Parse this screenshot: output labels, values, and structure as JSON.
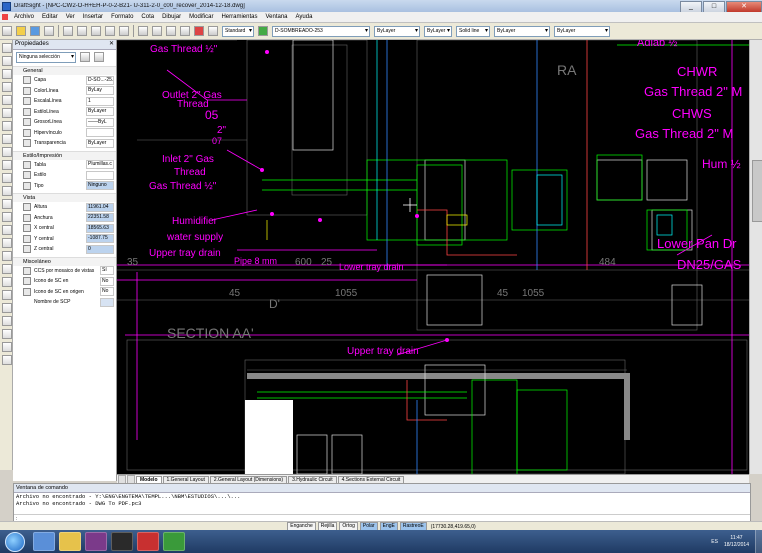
{
  "window": {
    "title": "DraftSight - [NPC-CW2-O-H+EH-P-0-2-B21- U-311-2-0_c00_recover_2014-12-18.dwg]"
  },
  "menu": [
    "Archivo",
    "Editar",
    "Ver",
    "Insertar",
    "Formato",
    "Cota",
    "Dibujar",
    "Modificar",
    "Herramientas",
    "Ventana",
    "Ayuda"
  ],
  "toolbar": {
    "style_combo": "Standard",
    "layer_combo": "D-SOMBREADO-253",
    "color_combo": "ByLayer",
    "linecolor_combo": "ByLayer",
    "linetype_combo": "Solid line",
    "lineweight_combo": "ByLayer",
    "last_combo": "ByLayer"
  },
  "properties": {
    "header": "Propiedades",
    "selection": "Ninguna selección",
    "sections": {
      "general": "General",
      "print": "Estilo/Impresión",
      "view": "Vista",
      "misc": "Misceláneo"
    },
    "general_rows": [
      {
        "name": "Capa",
        "value": "D-SO...-25..."
      },
      {
        "name": "ColorLínea",
        "value": "ByLay"
      },
      {
        "name": "EscalaLínea",
        "value": "1"
      },
      {
        "name": "EstiloLínea",
        "value": "ByLayer"
      },
      {
        "name": "GrosorLínea",
        "value": "——ByL"
      },
      {
        "name": "Hipervínculo",
        "value": ""
      },
      {
        "name": "Transparencia",
        "value": "ByLayer"
      }
    ],
    "print_rows": [
      {
        "name": "Tabla",
        "value": "Plumillas.c"
      },
      {
        "name": "Estilo",
        "value": ""
      },
      {
        "name": "Tipo",
        "value": "Ninguno"
      }
    ],
    "view_rows": [
      {
        "name": "Altura",
        "value": "11961.04"
      },
      {
        "name": "Anchura",
        "value": "22351.58"
      },
      {
        "name": "X central",
        "value": "18565.63"
      },
      {
        "name": "Y central",
        "value": "-1087.75"
      },
      {
        "name": "Z central",
        "value": "0"
      }
    ],
    "misc_rows": [
      {
        "name": "CCS por mosaico de vistas",
        "value": "Sí"
      },
      {
        "name": "Icono de SC en",
        "value": "No"
      },
      {
        "name": "Icono de SC en origen",
        "value": "No"
      },
      {
        "name": "Nombre de SCP",
        "value": ""
      }
    ]
  },
  "drawing": {
    "labels": {
      "gas_thread_top": "Gas Thread ½\"",
      "outlet": "Outlet 2\" Gas",
      "outlet2": "Thread",
      "inlet": "Inlet 2\" Gas",
      "inlet2": "Thread",
      "inlet3": "Gas Thread ½\"",
      "humidifier": "Humidifier",
      "water_supply": "water supply",
      "upper_tray": "Upper tray drain",
      "pipe": "Pipe 8 mm",
      "lower_tray": "Lower tray drain",
      "section": "SECTION AA'",
      "upper_tray2": "Upper tray drain",
      "ra": "RA",
      "adiab": "Adiab ½",
      "chwr": "CHWR",
      "gas_right1": "Gas Thread 2\" M",
      "chws": "CHWS",
      "gas_right2": "Gas Thread 2\" M",
      "hum": "Hum ½",
      "lower_pan": "Lower Pan Dr",
      "dn25": "DN25/GAS",
      "d05": "05",
      "d2": "2\"",
      "d07": "07",
      "n35": "35",
      "n45a": "45",
      "n45b": "45",
      "n1055a": "1055",
      "n1055b": "1055",
      "n600": "600",
      "n25": "25",
      "n484": "484",
      "ddash": "D'"
    }
  },
  "tabs": [
    "Modelo",
    "1.General Layout",
    "2.General Layout (Dimensions)",
    "3.Hydraulic Circuit",
    "4.Sections External Circuit"
  ],
  "command": {
    "header": "Ventana de comando",
    "lines": [
      "Archivo no encontrado - Y:\\ENG\\ENGTEMA\\TEMPL...\\NBM\\ESTUDIOS\\...\\...",
      "Archivo no encontrado - DWG To PDF.pc3"
    ],
    "prompt": ":"
  },
  "status": {
    "buttons": [
      "Enganche",
      "Rejilla",
      "Ortog",
      "Polar",
      "EngE",
      "RastreoE"
    ],
    "active": [
      false,
      false,
      false,
      true,
      true,
      true
    ],
    "coords": "(17730.28,419.65,0)"
  },
  "taskbar": {
    "lang": "ES",
    "time": "11:47",
    "date": "18/12/2014"
  }
}
